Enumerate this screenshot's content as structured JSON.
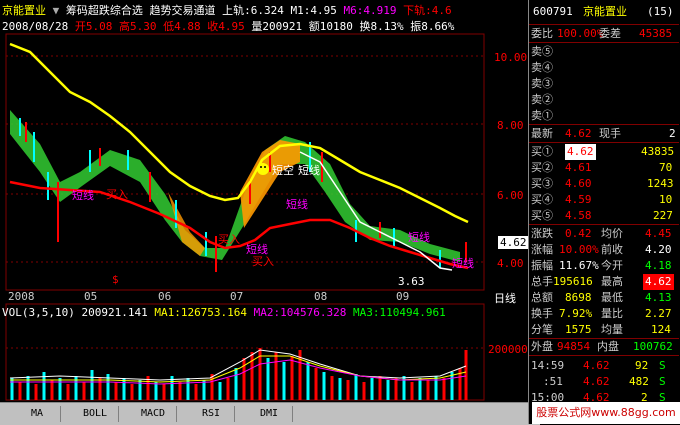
{
  "header": {
    "stock_name": "京能置业",
    "indicator_name": "筹码超跌综合选",
    "channel_name": "趋势交易通道",
    "upper_label": "上轨:6.324",
    "m1_label": "M1:4.95",
    "m6_label": "M6:4.919",
    "lower_label": "下轨:4.6",
    "date": "2008/08/28",
    "open": "开5.08",
    "high": "高5.30",
    "low": "低4.88",
    "close": "收4.95",
    "volume": "量200921",
    "amount": "额10180",
    "turnover": "换8.13%",
    "amplitude": "振8.66%"
  },
  "price_axis": {
    "ticks": [
      "10.00",
      "8.00",
      "6.00",
      "4.00"
    ],
    "current_price": "4.62",
    "min_label": "3.63"
  },
  "time_axis": {
    "labels": [
      "2008",
      "05",
      "06",
      "07",
      "08",
      "09"
    ],
    "period": "日线"
  },
  "chart_labels": {
    "short_line_1": "短线",
    "buy_1": "买入",
    "short_line_2": "短线",
    "short_line_3": "短线",
    "buy_2": "买入",
    "short_line_4": "短线",
    "buy_3": "买入",
    "short_line_5": "短线",
    "short_empty": "短空",
    "short_line_6": "短线",
    "dollar_mark": "$"
  },
  "volume_panel": {
    "title": "VOL(3,5,10) 200921.141",
    "ma1": "MA1:126753.164",
    "ma2": "MA2:104576.328",
    "ma3": "MA3:110494.961",
    "tick": "200000"
  },
  "tabs": [
    "MA",
    "BOLL",
    "MACD",
    "RSI",
    "DMI"
  ],
  "side_panel": {
    "code": "600791",
    "name": "京能置业",
    "count": "(15)",
    "weibi_label": "委比",
    "weibi": "100.00%",
    "weicha_label": "委差",
    "weicha": "45385",
    "sells": [
      "卖⑤",
      "卖④",
      "卖③",
      "卖②",
      "卖①"
    ],
    "latest_label": "最新",
    "latest": "4.62",
    "xianshou_label": "现手",
    "xianshou": "2",
    "buys": [
      {
        "label": "买①",
        "price": "4.62",
        "vol": "43835"
      },
      {
        "label": "买②",
        "price": "4.61",
        "vol": "70"
      },
      {
        "label": "买③",
        "price": "4.60",
        "vol": "1243"
      },
      {
        "label": "买④",
        "price": "4.59",
        "vol": "10"
      },
      {
        "label": "买⑤",
        "price": "4.58",
        "vol": "227"
      }
    ],
    "stats": [
      {
        "l1": "涨跌",
        "v1": "0.42",
        "l2": "均价",
        "v2": "4.45"
      },
      {
        "l1": "涨幅",
        "v1": "10.00%",
        "l2": "前收",
        "v2": "4.20"
      },
      {
        "l1": "振幅",
        "v1": "11.67%",
        "l2": "今开",
        "v2": "4.18"
      },
      {
        "l1": "总手",
        "v1": "195616",
        "l2": "最高",
        "v2": "4.62"
      },
      {
        "l1": "总额",
        "v1": "8698",
        "l2": "最低",
        "v2": "4.13"
      },
      {
        "l1": "换手",
        "v1": "7.92%",
        "l2": "量比",
        "v2": "2.27"
      },
      {
        "l1": "分笔",
        "v1": "1575",
        "l2": "均量",
        "v2": "124"
      }
    ],
    "outer_label": "外盘",
    "outer": "94854",
    "inner_label": "内盘",
    "inner": "100762",
    "ticks": [
      {
        "time": "14:59",
        "price": "4.62",
        "vol": "92",
        "side": "S"
      },
      {
        "time": ":51",
        "price": "4.62",
        "vol": "482",
        "side": "S"
      },
      {
        "time": "15:00",
        "price": "4.62",
        "vol": "2",
        "side": "S"
      }
    ]
  },
  "brand": "股票公式网www.88gg.com"
}
